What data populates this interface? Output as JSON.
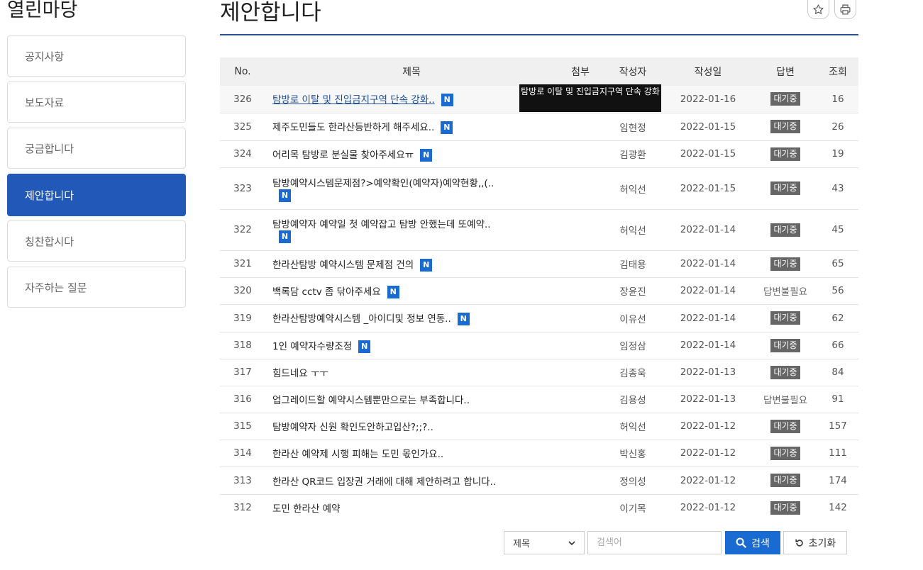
{
  "sidebar": {
    "title": "열린마당",
    "items": [
      {
        "label": "공지사항",
        "active": false
      },
      {
        "label": "보도자료",
        "active": false
      },
      {
        "label": "궁금합니다",
        "active": false
      },
      {
        "label": "제안합니다",
        "active": true
      },
      {
        "label": "칭찬합시다",
        "active": false
      },
      {
        "label": "자주하는 질문",
        "active": false
      }
    ]
  },
  "header": {
    "title": "제안합니다",
    "favorite_icon": "star-icon",
    "print_icon": "printer-icon"
  },
  "table": {
    "columns": [
      "No.",
      "제목",
      "첨부",
      "작성자",
      "작성일",
      "답변",
      "조회"
    ],
    "rows": [
      {
        "no": "326",
        "title": "탐방로 이탈 및 진입금지구역 단속 강화..",
        "new": "N",
        "author": "",
        "date": "2022-01-16",
        "status": "대기중",
        "views": "16"
      },
      {
        "no": "325",
        "title": "제주도민들도 한라산등반하게 해주세요..",
        "new": "N",
        "author": "임현정",
        "date": "2022-01-15",
        "status": "대기중",
        "views": "26"
      },
      {
        "no": "324",
        "title": "어리목 탐방로 분실물 찾아주세요ㅠ",
        "new": "N",
        "author": "김광환",
        "date": "2022-01-15",
        "status": "대기중",
        "views": "19"
      },
      {
        "no": "323",
        "title": "탐방예약시스템문제점?>예약확인(예약자)예약현황,,(..",
        "new": "N",
        "author": "허익선",
        "date": "2022-01-15",
        "status": "대기중",
        "views": "43"
      },
      {
        "no": "322",
        "title": "탐방예약자 예약일 첫 예약잡고 탐방 안했는데 또예약..",
        "new": "N",
        "author": "허익선",
        "date": "2022-01-14",
        "status": "대기중",
        "views": "45"
      },
      {
        "no": "321",
        "title": "한라산탐방 예약시스템 문제점 건의",
        "new": "N",
        "author": "김태용",
        "date": "2022-01-14",
        "status": "대기중",
        "views": "65"
      },
      {
        "no": "320",
        "title": "백록담 cctv 좀 닦아주세요",
        "new": "N",
        "author": "장윤진",
        "date": "2022-01-14",
        "status": "답변불필요",
        "views": "56"
      },
      {
        "no": "319",
        "title": "한라산탐방예약시스템 _아이디및 정보 연동..",
        "new": "N",
        "author": "이유선",
        "date": "2022-01-14",
        "status": "대기중",
        "views": "62"
      },
      {
        "no": "318",
        "title": "1인 예약자수량조정",
        "new": "N",
        "author": "임정삼",
        "date": "2022-01-14",
        "status": "대기중",
        "views": "66"
      },
      {
        "no": "317",
        "title": "힘드네요 ㅜㅜ",
        "new": "",
        "author": "김종욱",
        "date": "2022-01-13",
        "status": "대기중",
        "views": "84"
      },
      {
        "no": "316",
        "title": "업그레이드할 예약시스템뿐만으로는 부족합니다..",
        "new": "",
        "author": "김용성",
        "date": "2022-01-13",
        "status": "답변불필요",
        "views": "91"
      },
      {
        "no": "315",
        "title": "탐방예약자 신원 확인도안하고입산?;;?..",
        "new": "",
        "author": "허익선",
        "date": "2022-01-12",
        "status": "대기중",
        "views": "157"
      },
      {
        "no": "314",
        "title": "한라산 예약제 시행 피해는 도민 몫인가요..",
        "new": "",
        "author": "박신홍",
        "date": "2022-01-12",
        "status": "대기중",
        "views": "111"
      },
      {
        "no": "313",
        "title": "한라산 QR코드 입장권 거래에 대해 제안하려고 합니다..",
        "new": "",
        "author": "정의성",
        "date": "2022-01-12",
        "status": "대기중",
        "views": "174"
      },
      {
        "no": "312",
        "title": "도민 한라산 예약",
        "new": "",
        "author": "이기목",
        "date": "2022-01-12",
        "status": "대기중",
        "views": "142"
      }
    ]
  },
  "tooltip": {
    "text": "탐방로 이탈 및 진입금지구역 단속 강화"
  },
  "search": {
    "field_selected": "제목",
    "placeholder": "검색어",
    "search_label": "검색",
    "reset_label": "초기화"
  },
  "colors": {
    "accent": "#2258b8",
    "badge_new": "#1a6bd1",
    "status_wait": "#666666"
  }
}
